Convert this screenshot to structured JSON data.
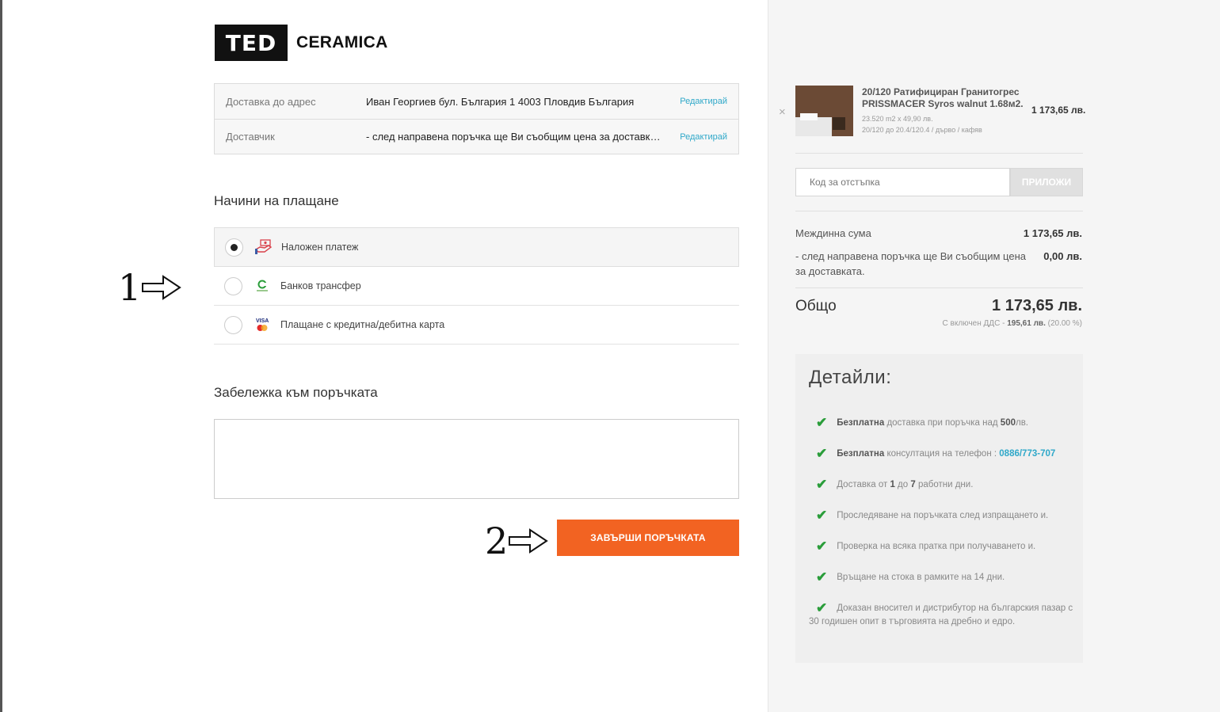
{
  "logo": {
    "mark": "TED",
    "text": "CERAMICA"
  },
  "shipping_info": [
    {
      "label": "Доставка до адрес",
      "value": "Иван Георгиев бул. България 1 4003 Пловдив България",
      "edit": "Редактирай"
    },
    {
      "label": "Доставчик",
      "value": "- след направена поръчка ще Ви съобщим цена за доставката за доставката.",
      "edit": "Редактирай"
    }
  ],
  "payment": {
    "title": "Начини на плащане",
    "options": [
      {
        "label": "Наложен платеж",
        "selected": true,
        "icon": "cash-hand-icon"
      },
      {
        "label": "Банков трансфер",
        "selected": false,
        "icon": "bank-icon"
      },
      {
        "label": "Плащане с кредитна/дебитна карта",
        "selected": false,
        "icon": "credit-card-icon"
      }
    ]
  },
  "note": {
    "title": "Забележка към поръчката",
    "value": ""
  },
  "submit_label": "ЗАВЪРШИ ПОРЪЧКАТА",
  "annotations": {
    "one": "1",
    "two": "2"
  },
  "cart": {
    "remove": "×",
    "product": {
      "name": "20/120 Ратифициран Гранитогрес PRISSMACER Syros walnut 1.68м2.",
      "qty_line": "23.520 m2 x 49,90 лв.",
      "attr_line": "20/120 до 20.4/120.4 / дърво / кафяв",
      "price": "1 173,65 лв."
    },
    "coupon": {
      "placeholder": "Код за отстъпка",
      "button": "ПРИЛОЖИ"
    },
    "subtotal": {
      "label": "Междинна сума",
      "value": "1 173,65 лв."
    },
    "shipping": {
      "label": "- след направена поръчка ще Ви съобщим цена за доставката.",
      "value": "0,00 лв."
    },
    "total": {
      "label": "Общо",
      "value": "1 173,65 лв."
    },
    "vat": {
      "prefix": "С включен ДДС -",
      "amount": "195,61 лв.",
      "percent": "(20.00 %)"
    }
  },
  "details": {
    "title": "Детайли:",
    "items": [
      {
        "bold": "Безплатна",
        "text": " доставка при поръчка над ",
        "bold2": "500",
        "tail": "лв."
      },
      {
        "bold": "Безплатна",
        "text": " консултация на телефон : ",
        "phone": "0886/773-707"
      },
      {
        "text_a": "Доставка от ",
        "b1": "1",
        "text_b": " до ",
        "b2": "7",
        "text_c": " работни дни."
      },
      {
        "text": "Проследяване на поръчката след изпращането и."
      },
      {
        "text": "Проверка на всяка пратка при получаването и."
      },
      {
        "text": "Връщане на стока в рамките на 14 дни."
      },
      {
        "text": "Доказан вносител и дистрибутор на българския пазар с 30 годишен опит в търговията на дребно и едро."
      }
    ]
  },
  "colors": {
    "accent": "#f26322",
    "link": "#2fa8c9",
    "check": "#2a9d3a"
  }
}
